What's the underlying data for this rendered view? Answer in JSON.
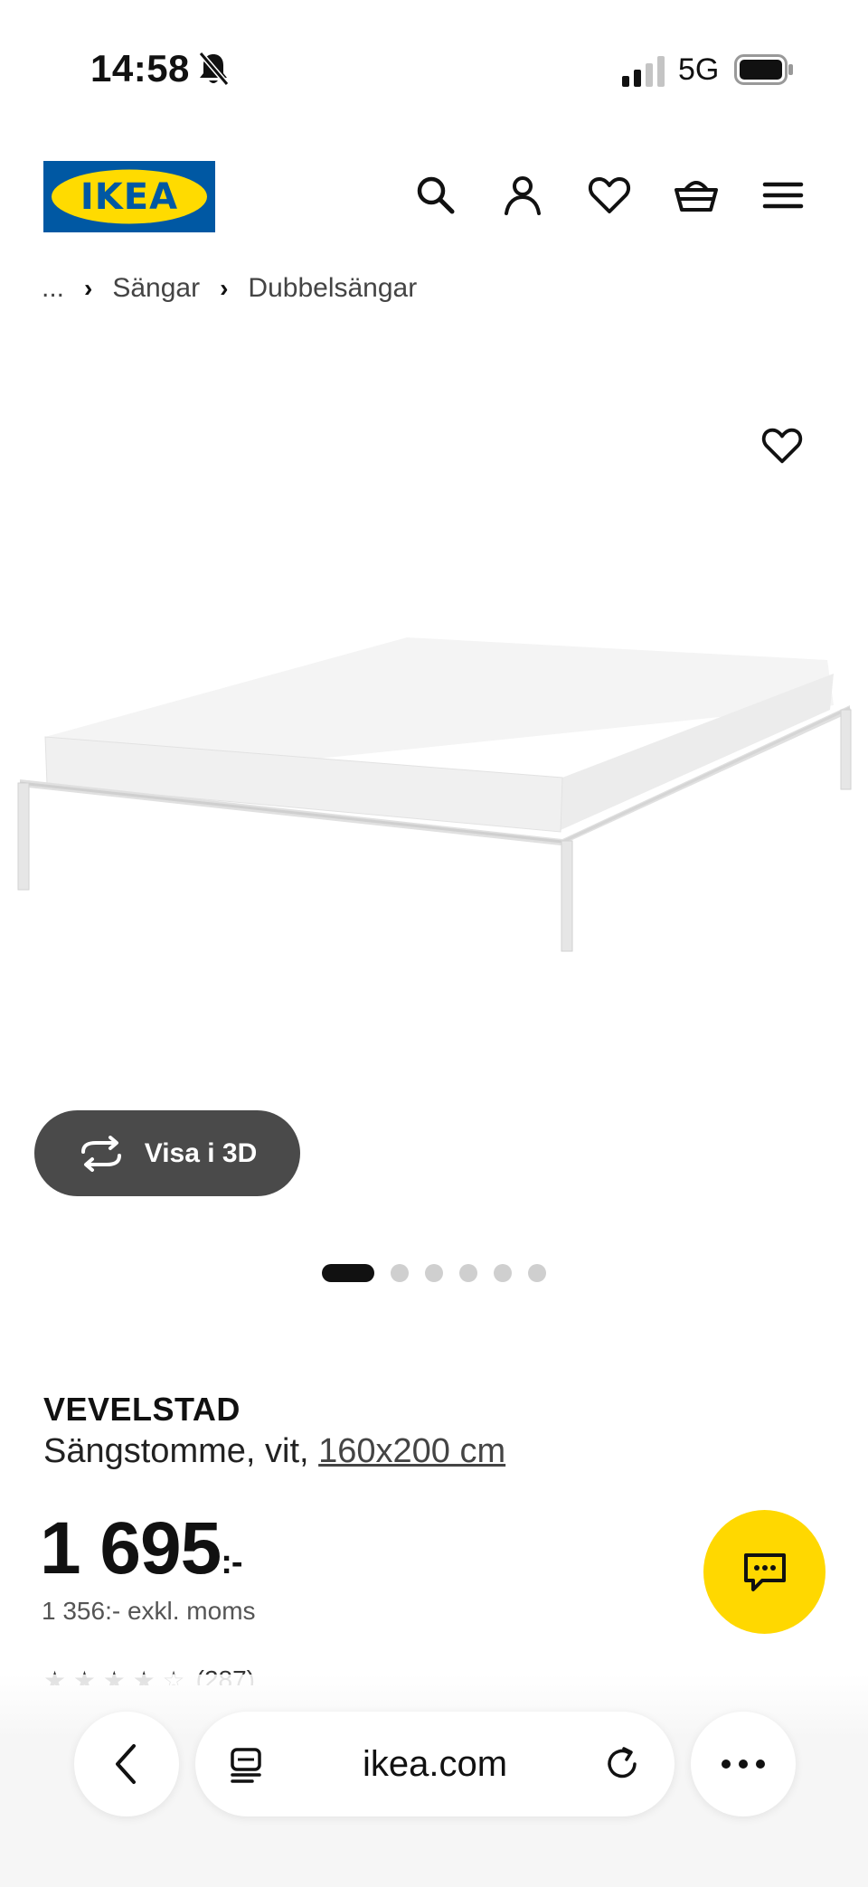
{
  "status": {
    "time": "14:58",
    "network": "5G"
  },
  "header": {
    "logo_text": "IKEA"
  },
  "breadcrumb": {
    "root": "...",
    "items": [
      "Sängar",
      "Dubbelsängar"
    ]
  },
  "gallery": {
    "view3d_label": "Visa i 3D",
    "dots_total": 6,
    "active_index": 0
  },
  "product": {
    "name": "VEVELSTAD",
    "description": "Sängstomme, vit, ",
    "size": "160x200 cm",
    "price": "1 695",
    "price_suffix": ":-",
    "price_ex_vat": "1 356:- exkl. moms",
    "rating_count": "(287)"
  },
  "browser": {
    "url": "ikea.com"
  },
  "colors": {
    "ikea_blue": "#0058a3",
    "ikea_yellow": "#ffdb00",
    "chat_yellow": "#ffd800",
    "button_dark": "#4a4a4a"
  }
}
